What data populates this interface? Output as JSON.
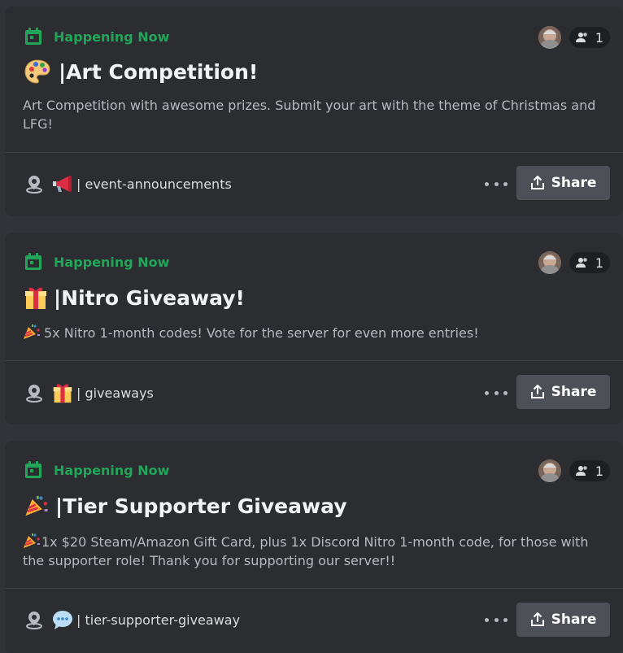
{
  "events": [
    {
      "status": "Happening Now",
      "attendee_count": "1",
      "title_separator": "| ",
      "title": "Art Competition!",
      "title_icon": "artist-palette-icon",
      "description": "Art Competition with awesome prizes. Submit your art with the theme of Christmas and LFG!",
      "channel_emoji": "megaphone-icon",
      "channel": "| event-announcements",
      "share_label": "Share"
    },
    {
      "status": "Happening Now",
      "attendee_count": "1",
      "title_separator": "| ",
      "title": "Nitro Giveaway!",
      "title_icon": "gift-icon",
      "description_prefix_icon": "party-popper-icon",
      "description": "5x Nitro 1-month codes! Vote for the server for even more entries!",
      "channel_emoji": "gift-icon",
      "channel": "| giveaways",
      "share_label": "Share"
    },
    {
      "status": "Happening Now",
      "attendee_count": "1",
      "title_separator": "| ",
      "title": "Tier Supporter Giveaway",
      "title_icon": "party-popper-icon",
      "description_prefix_icon": "party-popper-icon",
      "description": "1x $20 Steam/Amazon Gift Card, plus 1x Discord Nitro 1-month code, for those with the supporter role! Thank you for supporting our server!!",
      "channel_emoji": "speech-bubble-icon",
      "channel": "| tier-supporter-giveaway",
      "share_label": "Share"
    }
  ],
  "colors": {
    "background": "#313338",
    "card": "#2b2d31",
    "status_green": "#23a559",
    "button": "#4e5058"
  }
}
